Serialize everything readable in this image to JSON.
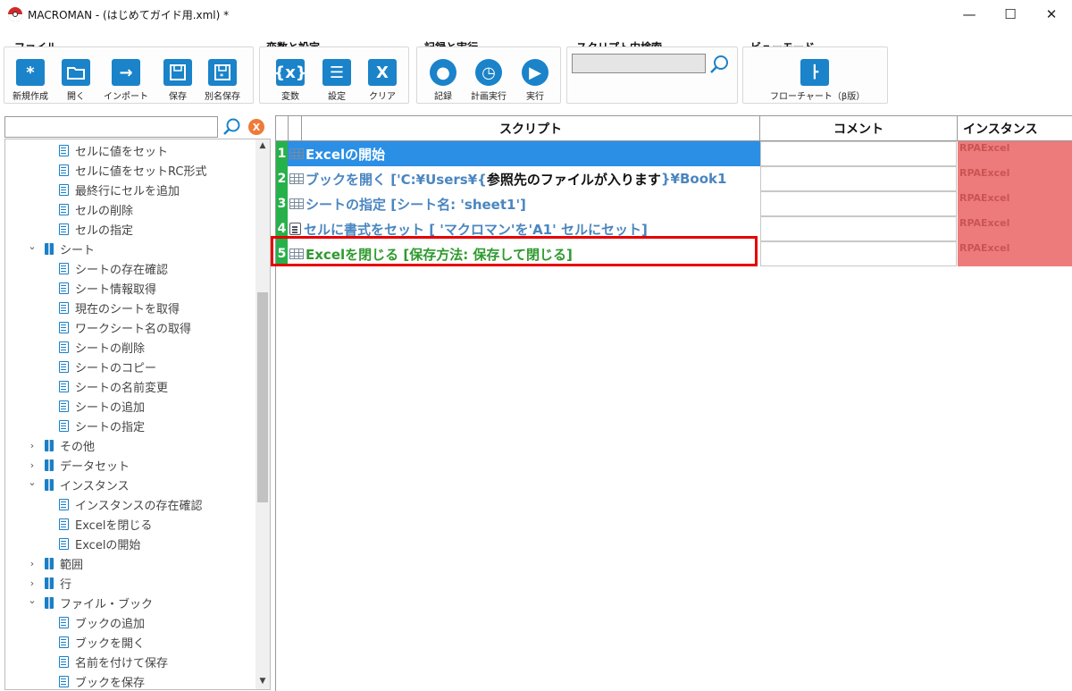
{
  "window": {
    "title": "MACROMAN - (はじめてガイド用.xml) *",
    "minimize": "—",
    "maximize": "☐",
    "close": "✕"
  },
  "ribbon": {
    "file": {
      "title": "ファイル",
      "buttons": [
        {
          "icon": "asterisk-icon",
          "glyph": "*",
          "label": "新規作成"
        },
        {
          "icon": "folder-icon",
          "glyph": "",
          "label": "開く"
        },
        {
          "icon": "arrow-right-icon",
          "glyph": "→",
          "label": "インポート"
        },
        {
          "icon": "save-icon",
          "glyph": "",
          "label": "保存"
        },
        {
          "icon": "save-as-icon",
          "glyph": "",
          "label": "別名保存"
        }
      ]
    },
    "variables": {
      "title": "変数と設定",
      "buttons": [
        {
          "icon": "variable-icon",
          "glyph": "{x}",
          "label": "変数"
        },
        {
          "icon": "settings-list-icon",
          "glyph": "☰",
          "label": "設定"
        },
        {
          "icon": "clear-icon",
          "glyph": "X",
          "label": "クリア"
        }
      ]
    },
    "record": {
      "title": "記録と実行",
      "buttons": [
        {
          "icon": "record-icon",
          "glyph": "●",
          "label": "記録"
        },
        {
          "icon": "schedule-icon",
          "glyph": "◷",
          "label": "計画実行"
        },
        {
          "icon": "play-icon",
          "glyph": "▶",
          "label": "実行"
        }
      ]
    },
    "search": {
      "title": "スクリプト内検索",
      "value": ""
    },
    "view": {
      "title": "ビューモード",
      "button": {
        "icon": "flowchart-icon",
        "label": "フローチャート（β版）"
      }
    }
  },
  "left_panel": {
    "search_value": "",
    "tree": [
      {
        "kind": "doc",
        "label": "セルに値をセット"
      },
      {
        "kind": "doc",
        "label": "セルに値をセットRC形式"
      },
      {
        "kind": "doc",
        "label": "最終行にセルを追加"
      },
      {
        "kind": "doc",
        "label": "セルの削除"
      },
      {
        "kind": "doc",
        "label": "セルの指定"
      },
      {
        "kind": "folder",
        "expanded": true,
        "label": "シート"
      },
      {
        "kind": "doc",
        "label": "シートの存在確認"
      },
      {
        "kind": "doc",
        "label": "シート情報取得"
      },
      {
        "kind": "doc",
        "label": "現在のシートを取得"
      },
      {
        "kind": "doc",
        "label": "ワークシート名の取得"
      },
      {
        "kind": "doc",
        "label": "シートの削除"
      },
      {
        "kind": "doc",
        "label": "シートのコピー"
      },
      {
        "kind": "doc",
        "label": "シートの名前変更"
      },
      {
        "kind": "doc",
        "label": "シートの追加"
      },
      {
        "kind": "doc",
        "label": "シートの指定"
      },
      {
        "kind": "folder",
        "expanded": false,
        "label": "その他"
      },
      {
        "kind": "folder",
        "expanded": false,
        "label": "データセット"
      },
      {
        "kind": "folder",
        "expanded": true,
        "label": "インスタンス"
      },
      {
        "kind": "doc",
        "label": "インスタンスの存在確認"
      },
      {
        "kind": "doc",
        "label": "Excelを閉じる"
      },
      {
        "kind": "doc",
        "label": "Excelの開始"
      },
      {
        "kind": "folder",
        "expanded": false,
        "label": "範囲"
      },
      {
        "kind": "folder",
        "expanded": false,
        "label": "行"
      },
      {
        "kind": "folder",
        "expanded": true,
        "label": "ファイル・ブック"
      },
      {
        "kind": "doc",
        "label": "ブックの追加"
      },
      {
        "kind": "doc",
        "label": "ブックを開く"
      },
      {
        "kind": "doc",
        "label": "名前を付けて保存"
      },
      {
        "kind": "doc",
        "label": "ブックを保存"
      }
    ]
  },
  "grid": {
    "headers": {
      "script": "スクリプト",
      "comment": "コメント",
      "instance": "インスタンス"
    },
    "rows": [
      {
        "num": "1",
        "icon": "grid",
        "parts": [
          {
            "t": "Excelの開始",
            "c": "#ffffff"
          }
        ],
        "comment": "",
        "instance": "RPAExcel",
        "selected": true
      },
      {
        "num": "2",
        "icon": "grid",
        "parts": [
          {
            "t": "ブックを開く ['C:¥Users¥{",
            "c": "#4a86c0"
          },
          {
            "t": "参照先のファイルが入ります",
            "c": "#111111"
          },
          {
            "t": "}¥Book1",
            "c": "#4a86c0"
          }
        ],
        "comment": "",
        "instance": "RPAExcel",
        "selected": false
      },
      {
        "num": "3",
        "icon": "grid",
        "parts": [
          {
            "t": "シートの指定 [シート名: 'sheet1']",
            "c": "#4a86c0"
          }
        ],
        "comment": "",
        "instance": "RPAExcel",
        "selected": false
      },
      {
        "num": "4",
        "icon": "doc",
        "parts": [
          {
            "t": "セルに書式をセット [ 'マクロマン'を'A1' セルにセット]",
            "c": "#4a86c0"
          }
        ],
        "comment": "",
        "instance": "RPAExcel",
        "selected": false
      },
      {
        "num": "5",
        "icon": "grid",
        "parts": [
          {
            "t": "Excelを閉じる [保存方法: 保存して閉じる]",
            "c": "#2e9a2e"
          }
        ],
        "comment": "",
        "instance": "RPAExcel",
        "selected": false
      }
    ]
  },
  "colors": {
    "accent_blue": "#1a83c9",
    "selected_row": "#2b8fe6",
    "row_number_green": "#27b14a",
    "instance_red": "#ee7b7b",
    "highlight_red": "#e60000"
  }
}
